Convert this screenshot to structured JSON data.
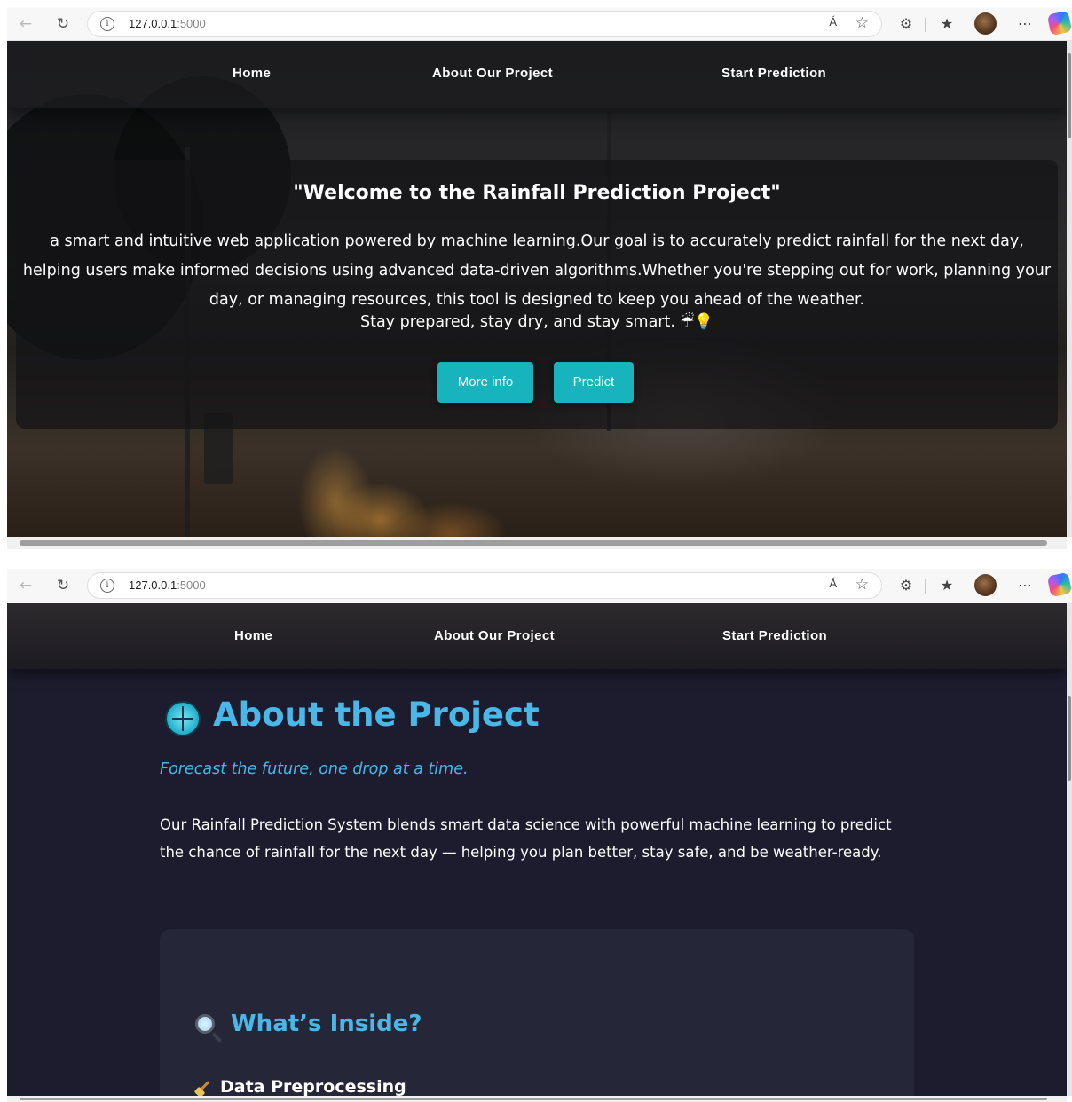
{
  "browser": {
    "url_host": "127.0.0.1",
    "url_port": ":5000",
    "read_aloud": "Á"
  },
  "nav": {
    "home": "Home",
    "about": "About Our Project",
    "predict": "Start Prediction"
  },
  "hero": {
    "title": "\"Welcome to the Rainfall Prediction Project\"",
    "description": "a smart and intuitive web application powered by machine learning.Our goal is to accurately predict rainfall for the next day, helping users make informed decisions using advanced data-driven algorithms.Whether you're stepping out for work, planning your day, or managing resources, this tool is designed to keep you ahead of the weather.",
    "stay": "Stay prepared, stay dry, and stay smart. ☔💡",
    "more_info_label": "More info",
    "predict_label": "Predict"
  },
  "about": {
    "title": "About the Project",
    "tagline": "Forecast the future, one drop at a time.",
    "text": "Our Rainfall Prediction System blends smart data science with powerful machine learning to predict the chance of rainfall for the next day — helping you plan better, stay safe, and be weather-ready.",
    "inside_title": "What’s Inside?",
    "first_item": "Data Preprocessing"
  },
  "icons": {
    "globe": "globe-icon",
    "magnifier": "magnifying-glass-icon",
    "broom": "broom-icon"
  },
  "colors": {
    "accent_button": "#17b4bd",
    "about_heading": "#49b8e8",
    "about_bg": "#1d1c2e",
    "card_bg": "#252637"
  }
}
